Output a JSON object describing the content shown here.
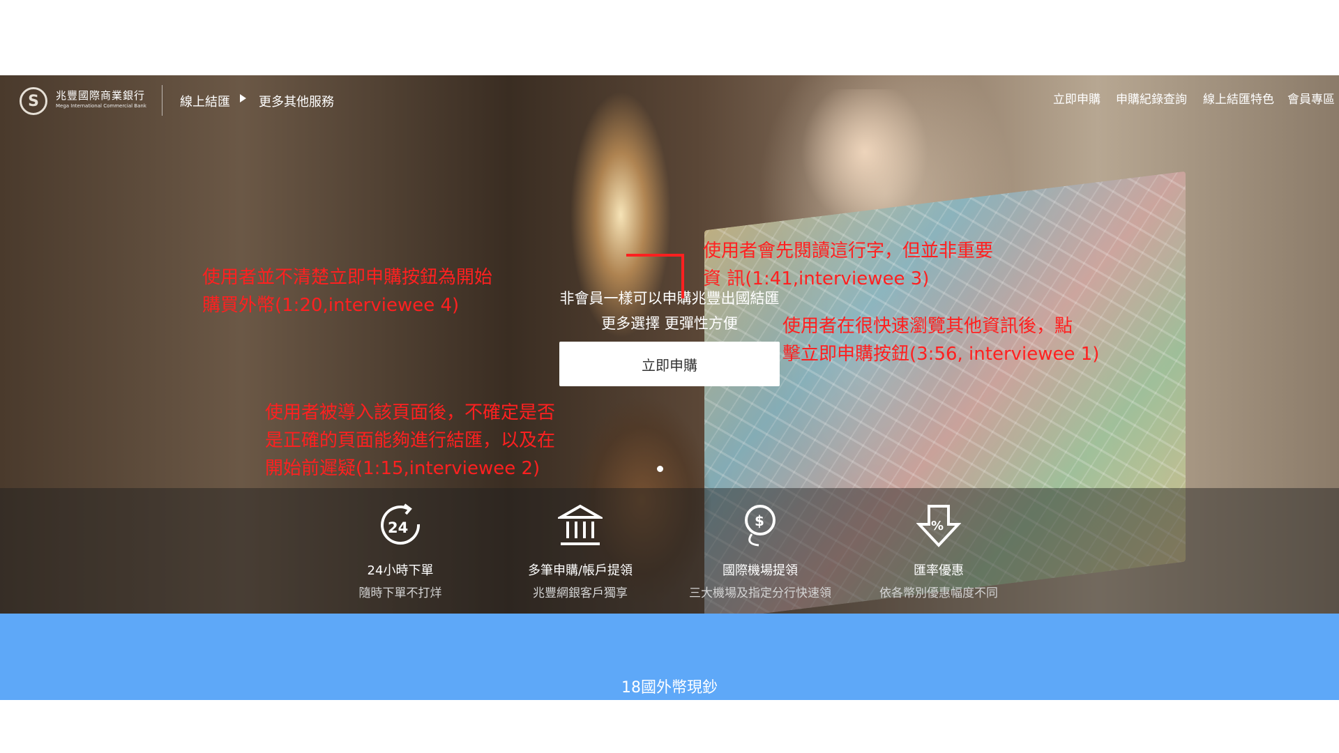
{
  "nav": {
    "logo_mark": "S",
    "logo_name": "兆豐國際商業銀行",
    "logo_sub": "Mega International Commercial Bank",
    "breadcrumb": [
      "線上結匯",
      "更多其他服務"
    ],
    "links": [
      "立即申購",
      "申購紀錄查詢",
      "線上結匯特色",
      "會員專區"
    ]
  },
  "hero": {
    "tagline_1": "非會員一樣可以申購兆豐出國結匯",
    "tagline_2": "更多選擇 更彈性方便",
    "cta_label": "立即申購"
  },
  "features": [
    {
      "icon": "24-hour-icon",
      "title": "24小時下單",
      "subtitle": "隨時下單不打烊"
    },
    {
      "icon": "bank-icon",
      "title": "多筆申購/帳戶提領",
      "subtitle": "兆豐網銀客戶獨享"
    },
    {
      "icon": "airport-money-icon",
      "title": "國際機場提領",
      "subtitle": "三大機場及指定分行快速領"
    },
    {
      "icon": "discount-icon",
      "title": "匯率優惠",
      "subtitle": "依各幣別優惠幅度不同"
    }
  ],
  "band": {
    "title": "18國外幣現鈔",
    "color": "#5ea8f8"
  },
  "annotations": {
    "color": "#ff2020",
    "note_1": [
      "使用者並不清楚立即申購按鈕為開始",
      "購買外幣(1:20,interviewee 4)"
    ],
    "note_2": [
      "使用者會先閱讀這行字，但並非重要",
      "資 訊(1:41,interviewee 3)"
    ],
    "note_3": [
      "使用者在很快速瀏覽其他資訊後，點",
      "擊立即申購按鈕(3:56, interviewee 1)"
    ],
    "note_4": [
      "使用者被導入該頁面後，不確定是否",
      "是正確的頁面能夠進行結匯，以及在",
      "開始前遲疑(1:15,interviewee 2)"
    ]
  }
}
